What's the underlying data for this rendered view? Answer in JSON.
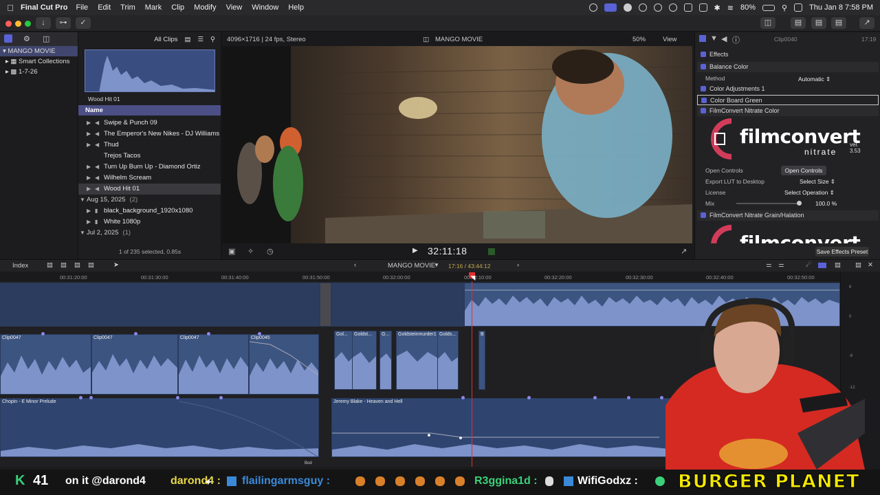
{
  "menubar": {
    "app_name": "Final Cut Pro",
    "menus": [
      "File",
      "Edit",
      "Trim",
      "Mark",
      "Clip",
      "Modify",
      "View",
      "Window",
      "Help"
    ],
    "battery": "80%",
    "datetime": "Thu Jan 8  7:58 PM"
  },
  "sidebar": {
    "items": [
      {
        "label": "MANGO MOVIE",
        "selected": true
      },
      {
        "label": "Smart Collections",
        "selected": false
      },
      {
        "label": "1-7-26",
        "selected": false
      }
    ]
  },
  "browser": {
    "filter_label": "All Clips",
    "thumbnail_label": "Wood Hit 01",
    "column_name": "Name",
    "rows": [
      {
        "label": "Swipe & Punch 09",
        "type": "audio"
      },
      {
        "label": "The Emperor's New Nikes - DJ Williams",
        "type": "audio"
      },
      {
        "label": "Thud",
        "type": "audio"
      },
      {
        "label": "Trejos Tacos",
        "type": "clip"
      },
      {
        "label": "Turn Up Burn Up - Diamond Ortiz",
        "type": "audio"
      },
      {
        "label": "Wilhelm Scream",
        "type": "audio"
      },
      {
        "label": "Wood Hit 01",
        "type": "audio",
        "selected": true
      }
    ],
    "date_group_1": {
      "label": "Aug 15, 2025",
      "count": "(2)"
    },
    "date_group_1_rows": [
      "black_background_1920x1080",
      "White 1080p"
    ],
    "date_group_2": {
      "label": "Jul 2, 2025",
      "count": "(1)"
    },
    "status": "1 of 235 selected, 0.85s"
  },
  "viewer": {
    "format": "4096×1716 | 24 fps, Stereo",
    "project": "MANGO MOVIE",
    "zoom": "50%",
    "view_label": "View",
    "timecode": "32:11:18"
  },
  "inspector": {
    "clip_name": "Clip0040",
    "duration": "17:19",
    "section": "Effects",
    "effects": [
      "Balance Color",
      "Color Adjustments 1",
      "Color Board Green",
      "FilmConvert Nitrate Color"
    ],
    "method_label": "Method",
    "method_value": "Automatic",
    "logo_word": "filmconvert",
    "logo_sub": "nitrate",
    "version": "ver. 3.53",
    "open_controls_label": "Open Controls",
    "open_controls_button": "Open Controls",
    "export_lut_label": "Export LUT to Desktop",
    "export_lut_value": "Select Size",
    "license_label": "License",
    "license_value": "Select Operation",
    "mix_label": "Mix",
    "mix_value": "100.0",
    "mix_unit": "%",
    "grain_effect": "FilmConvert Nitrate Grain/Halation",
    "save_preset": "Save Effects Preset"
  },
  "timeline": {
    "index_label": "Index",
    "project": "MANGO MOVIE",
    "position": "17:16 / 43:44:12",
    "ruler_ticks": [
      "00:31:20:00",
      "00:31:30:00",
      "00:31:40:00",
      "00:31:50:00",
      "00:32:00:00",
      "00:32:10:00",
      "00:32:20:00",
      "00:32:30:00",
      "00:32:40:00",
      "00:32:50:00"
    ],
    "clips": [
      "Clip0047",
      "Clip0047",
      "Clip0047",
      "Clip0045",
      "Gol...",
      "Goldst...",
      "G...",
      "Goldsteinmurder1",
      "Golds...",
      "B"
    ],
    "music_1": "Chopin - E Minor Prelude",
    "music_2": "Jeremy Blake - Heaven and Hell",
    "small_label": "Bod",
    "meter_labels": [
      "6",
      "0",
      "-6",
      "-12"
    ]
  },
  "stream": {
    "count_prefix": "K",
    "count": "41",
    "msg1": "on it @darond4",
    "user1": "darond4 :",
    "user2": "flailingarmsguy :",
    "user3": "R3ggina1d :",
    "user4": "WifiGodxz :",
    "banner": "BURGER PLANET"
  },
  "colors": {
    "accent": "#5a62d6",
    "clip_blue": "#3c5480",
    "playhead": "#e03030",
    "banner_yellow": "#f3e800",
    "stream_green": "#3bd17a"
  }
}
